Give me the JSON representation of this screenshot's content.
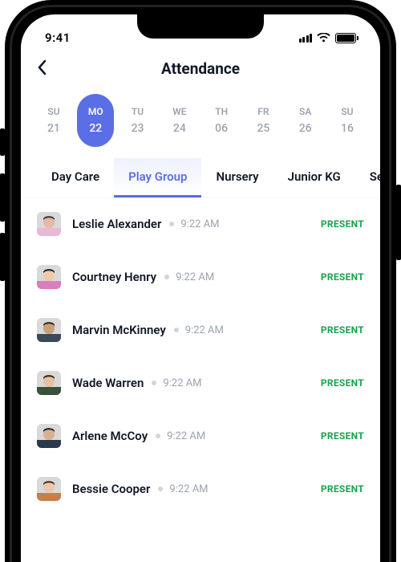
{
  "statusbar": {
    "time": "9:41"
  },
  "header": {
    "title": "Attendance"
  },
  "calendar": [
    {
      "dow": "SU",
      "date": "21",
      "active": false
    },
    {
      "dow": "MO",
      "date": "22",
      "active": true
    },
    {
      "dow": "TU",
      "date": "23",
      "active": false
    },
    {
      "dow": "WE",
      "date": "24",
      "active": false
    },
    {
      "dow": "TH",
      "date": "06",
      "active": false
    },
    {
      "dow": "FR",
      "date": "25",
      "active": false
    },
    {
      "dow": "SA",
      "date": "26",
      "active": false
    },
    {
      "dow": "SU",
      "date": "16",
      "active": false
    }
  ],
  "tabs": [
    {
      "label": "Day Care",
      "active": false
    },
    {
      "label": "Play Group",
      "active": true
    },
    {
      "label": "Nursery",
      "active": false
    },
    {
      "label": "Junior KG",
      "active": false
    },
    {
      "label": "Sen",
      "active": false
    }
  ],
  "students": [
    {
      "name": "Leslie Alexander",
      "time": "9:22 AM",
      "status": "PRESENT",
      "avatar": "person-1"
    },
    {
      "name": "Courtney Henry",
      "time": "9:22 AM",
      "status": "PRESENT",
      "avatar": "person-2"
    },
    {
      "name": "Marvin McKinney",
      "time": "9:22 AM",
      "status": "PRESENT",
      "avatar": "person-3"
    },
    {
      "name": "Wade Warren",
      "time": "9:22 AM",
      "status": "PRESENT",
      "avatar": "person-4"
    },
    {
      "name": "Arlene McCoy",
      "time": "9:22 AM",
      "status": "PRESENT",
      "avatar": "person-5"
    },
    {
      "name": "Bessie Cooper",
      "time": "9:22 AM",
      "status": "PRESENT",
      "avatar": "person-6"
    }
  ],
  "colors": {
    "accent": "#5a6ee5",
    "present": "#16a34a"
  }
}
